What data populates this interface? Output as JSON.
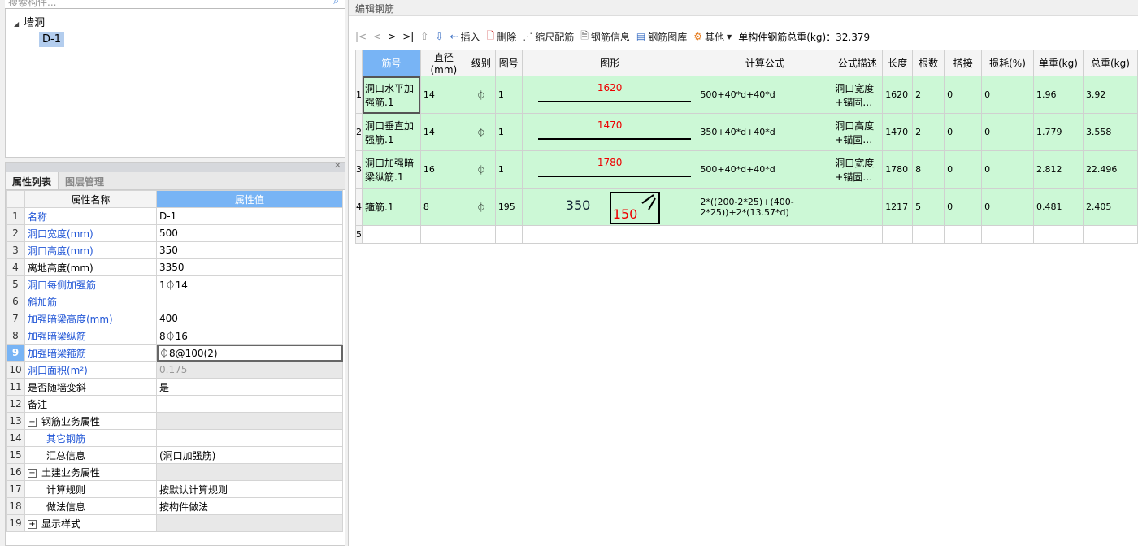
{
  "left": {
    "search_placeholder": "搜索构件...",
    "tree": {
      "root": "墙洞",
      "leaf": "D-1"
    },
    "tabs": [
      "属性列表",
      "图层管理"
    ],
    "headers": {
      "name": "属性名称",
      "value": "属性值"
    },
    "rows": [
      {
        "n": "1",
        "name": "名称",
        "value": "D-1",
        "style": "blue"
      },
      {
        "n": "2",
        "name": "洞口宽度(mm)",
        "value": "500",
        "style": "blue"
      },
      {
        "n": "3",
        "name": "洞口高度(mm)",
        "value": "350",
        "style": "blue"
      },
      {
        "n": "4",
        "name": "离地高度(mm)",
        "value": "3350",
        "style": ""
      },
      {
        "n": "5",
        "name": "洞口每侧加强筋",
        "value": "1⏀14",
        "style": "blue"
      },
      {
        "n": "6",
        "name": "斜加筋",
        "value": "",
        "style": "blue"
      },
      {
        "n": "7",
        "name": "加强暗梁高度(mm)",
        "value": "400",
        "style": "blue"
      },
      {
        "n": "8",
        "name": "加强暗梁纵筋",
        "value": "8⏀16",
        "style": "blue"
      },
      {
        "n": "9",
        "name": "加强暗梁箍筋",
        "value": "⏀8@100(2)",
        "style": "blue",
        "selected": true
      },
      {
        "n": "10",
        "name": "洞口面积(m²)",
        "value": "0.175",
        "style": "blue",
        "readonly": true
      },
      {
        "n": "11",
        "name": "是否随墙变斜",
        "value": "是",
        "style": ""
      },
      {
        "n": "12",
        "name": "备注",
        "value": "",
        "style": ""
      },
      {
        "n": "13",
        "name": "钢筋业务属性",
        "value": "",
        "style": "",
        "group": "−"
      },
      {
        "n": "14",
        "name": "其它钢筋",
        "value": "",
        "style": "blue",
        "child": true
      },
      {
        "n": "15",
        "name": "汇总信息",
        "value": "(洞口加强筋)",
        "style": "",
        "child": true
      },
      {
        "n": "16",
        "name": "土建业务属性",
        "value": "",
        "style": "",
        "group": "−"
      },
      {
        "n": "17",
        "name": "计算规则",
        "value": "按默认计算规则",
        "style": "",
        "child": true
      },
      {
        "n": "18",
        "name": "做法信息",
        "value": "按构件做法",
        "style": "",
        "child": true
      },
      {
        "n": "19",
        "name": "显示样式",
        "value": "",
        "style": "",
        "group": "+"
      }
    ]
  },
  "right": {
    "title": "编辑钢筋",
    "toolbar": {
      "first": "|<",
      "prev": "<",
      "next": ">",
      "last": ">|",
      "insert": "插入",
      "delete": "删除",
      "scale": "缩尺配筋",
      "info": "钢筋信息",
      "library": "钢筋图库",
      "other": "其他",
      "total_label": "单构件钢筋总重(kg)：32.379"
    },
    "columns": [
      "筋号",
      "直径(mm)",
      "级别",
      "图号",
      "图形",
      "计算公式",
      "公式描述",
      "长度",
      "根数",
      "搭接",
      "损耗(%)",
      "单重(kg)",
      "总重(kg)"
    ],
    "rows": [
      {
        "n": "1",
        "name": "洞口水平加强筋.1",
        "dia": "14",
        "grade": "⏀",
        "fig": "1",
        "shape": "1620",
        "formula": "500+40*d+40*d",
        "desc": "洞口宽度+锚固…",
        "len": "1620",
        "count": "2",
        "lap": "0",
        "loss": "0",
        "unit": "1.96",
        "total": "3.92"
      },
      {
        "n": "2",
        "name": "洞口垂直加强筋.1",
        "dia": "14",
        "grade": "⏀",
        "fig": "1",
        "shape": "1470",
        "formula": "350+40*d+40*d",
        "desc": "洞口高度+锚固…",
        "len": "1470",
        "count": "2",
        "lap": "0",
        "loss": "0",
        "unit": "1.779",
        "total": "3.558"
      },
      {
        "n": "3",
        "name": "洞口加强暗梁纵筋.1",
        "dia": "16",
        "grade": "⏀",
        "fig": "1",
        "shape": "1780",
        "formula": "500+40*d+40*d",
        "desc": "洞口宽度+锚固…",
        "len": "1780",
        "count": "8",
        "lap": "0",
        "loss": "0",
        "unit": "2.812",
        "total": "22.496"
      },
      {
        "n": "4",
        "name": "箍筋.1",
        "dia": "8",
        "grade": "⏀",
        "fig": "195",
        "shape_h": "350",
        "shape_w": "150",
        "formula": "2*((200-2*25)+(400-2*25))+2*(13.57*d)",
        "desc": "",
        "len": "1217",
        "count": "5",
        "lap": "0",
        "loss": "0",
        "unit": "0.481",
        "total": "2.405"
      }
    ],
    "empty_row": "5"
  }
}
